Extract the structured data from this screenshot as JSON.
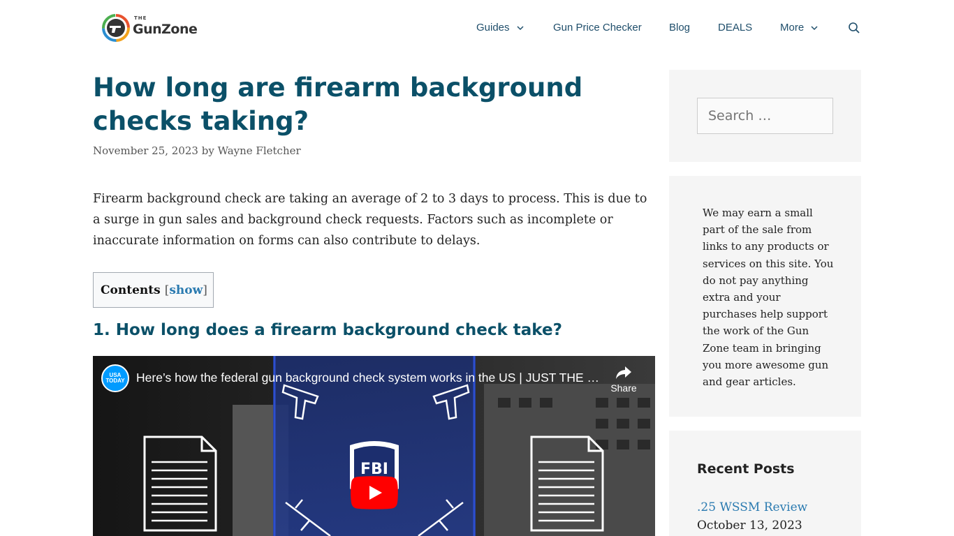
{
  "header": {
    "logo": {
      "small_text": "THE",
      "name": "GunZone"
    },
    "nav": [
      {
        "label": "Guides",
        "has_dropdown": true
      },
      {
        "label": "Gun Price Checker",
        "has_dropdown": false
      },
      {
        "label": "Blog",
        "has_dropdown": false
      },
      {
        "label": "DEALS",
        "has_dropdown": false
      },
      {
        "label": "More",
        "has_dropdown": true
      }
    ],
    "search_icon": "search-icon"
  },
  "article": {
    "title": "How long are firearm background checks taking?",
    "date": "November 25, 2023",
    "by": "by",
    "author": "Wayne Fletcher",
    "intro": "Firearm background check are taking an average of 2 to 3 days to process. This is due to a surge in gun sales and background check requests. Factors such as incomplete or inaccurate information on forms can also contribute to delays.",
    "toc": {
      "title": "Contents",
      "open_bracket": "[",
      "toggle": "show",
      "close_bracket": "]"
    },
    "section_heading": "1. How long does a firearm background check take?",
    "video": {
      "channel_logo_text": "USA TODAY",
      "title": "Here’s how the federal gun background check system works in the US | JUST THE FACTS",
      "share_label": "Share",
      "badge_text": "FBI"
    }
  },
  "sidebar": {
    "search_placeholder": "Search …",
    "disclosure": "We may earn a small part of the sale from links to any products or services on this site. You do not pay anything extra and your purchases help support the work of the Gun Zone team in bringing you more awesome gun and gear articles.",
    "recent_posts": {
      "heading": "Recent Posts",
      "items": [
        {
          "title": ".25 WSSM Review",
          "date": "October 13, 2023"
        }
      ]
    }
  },
  "colors": {
    "title": "#0b5068",
    "nav": "#1f4e6b",
    "link": "#2a7ab0",
    "widget_bg": "#f5f5f5",
    "youtube_red": "#ff0000"
  }
}
